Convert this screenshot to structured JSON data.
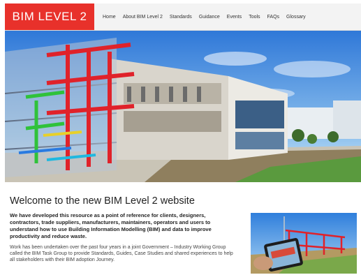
{
  "header": {
    "logo_text": "BIM LEVEL 2",
    "nav": [
      "Home",
      "About BIM Level 2",
      "Standards",
      "Guidance",
      "Events",
      "Tools",
      "FAQs",
      "Glossary"
    ]
  },
  "main": {
    "title": "Welcome to the new BIM Level 2 website",
    "lead": "We have developed this resource as a point of reference for clients, designers, contractors, trade suppliers, manufacturers, maintainers, operators and users to understand how to use Building Information Modelling (BIM) and data to improve productivity and reduce waste.",
    "body": "Work has been undertaken over the past four years in a joint Government – Industry Working Group called the BIM Task Group to provide Standards, Guides, Case Studies and shared experiences to help all stakeholders with their BIM adoption Journey."
  },
  "colors": {
    "brand_red": "#e8312b",
    "header_bg": "#f3f3f3"
  }
}
